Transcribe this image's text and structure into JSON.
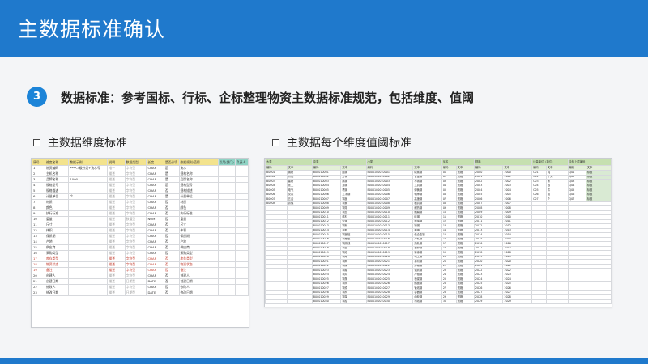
{
  "slide": {
    "title": "主数据标准确认",
    "step_number": "3",
    "headline": "数据标准：参考国标、行标、企标整理物资主数据标准规范，包括维度、值阈",
    "section_left_title": "主数据维度标准",
    "section_right_title": "主数据每个维度值阈标准"
  },
  "colors": {
    "header": "#1f79cc",
    "badge": "#1c84d8",
    "background": "#f4f5f7",
    "left_header": "#f3e38d",
    "right_header": "#c6e0b0"
  },
  "left_table": {
    "headers": [
      "序号",
      "维度名称",
      "数据示例",
      "说明",
      "数据类型",
      "长度",
      "是否必填",
      "数据规则/值阈",
      "引用(部门)",
      "负责人"
    ],
    "rows": [
      [
        "1",
        "物资编码",
        "****-3级分类+流水号",
        "唯一",
        "字符型",
        "CHAR",
        "是",
        "流水",
        "",
        ""
      ],
      [
        "2",
        "主机名称",
        "",
        "描述",
        "字符型",
        "CHAR",
        "是",
        "规格名称",
        "",
        ""
      ],
      [
        "3",
        "品牌名称",
        "1000",
        "描述",
        "字符型",
        "CHAR",
        "是",
        "品牌名称",
        "",
        ""
      ],
      [
        "4",
        "规格型号",
        "",
        "描述",
        "字符型",
        "CHAR",
        "是",
        "规格型号",
        "",
        ""
      ],
      [
        "5",
        "规格描述",
        "",
        "描述",
        "字符型",
        "CHAR",
        "否",
        "规格描述",
        "",
        ""
      ],
      [
        "6",
        "计量单位",
        "个",
        "描述",
        "字符型",
        "CHAR",
        "是",
        "计量单位",
        "",
        ""
      ],
      [
        "7",
        "材质",
        "",
        "描述",
        "字符型",
        "CHAR",
        "否",
        "材质",
        "",
        ""
      ],
      [
        "8",
        "颜色",
        "",
        "描述",
        "字符型",
        "CHAR",
        "否",
        "颜色",
        "",
        ""
      ],
      [
        "9",
        "执行标准",
        "",
        "描述",
        "字符型",
        "CHAR",
        "否",
        "执行标准",
        "",
        ""
      ],
      [
        "10",
        "重量",
        "",
        "描述",
        "数值型",
        "NUM",
        "否",
        "重量",
        "",
        ""
      ],
      [
        "11",
        "尺寸",
        "",
        "描述",
        "字符型",
        "CHAR",
        "否",
        "尺寸",
        "",
        ""
      ],
      [
        "12",
        "体积",
        "",
        "描述",
        "字符型",
        "CHAR",
        "否",
        "体积",
        "",
        ""
      ],
      [
        "13",
        "保质期",
        "",
        "描述",
        "字符型",
        "CHAR",
        "否",
        "保质期",
        "",
        ""
      ],
      [
        "14",
        "产地",
        "",
        "描述",
        "字符型",
        "CHAR",
        "否",
        "产地",
        "",
        ""
      ],
      [
        "15",
        "供应商",
        "",
        "描述",
        "字符型",
        "CHAR",
        "否",
        "供应商",
        "",
        ""
      ],
      [
        "16",
        "采购类型",
        "",
        "描述",
        "字符型",
        "CHAR",
        "否",
        "采购类型",
        "",
        ""
      ],
      [
        "17",
        "库存类型",
        "",
        "描述",
        "字符型",
        "CHAR",
        "否",
        "库存类型",
        "",
        ""
      ],
      [
        "18",
        "物资状态",
        "",
        "描述",
        "字符型",
        "CHAR",
        "否",
        "物资状态",
        "",
        ""
      ],
      [
        "19",
        "备注",
        "",
        "描述",
        "字符型",
        "CHAR",
        "否",
        "备注",
        "",
        ""
      ],
      [
        "20",
        "创建人",
        "",
        "描述",
        "字符型",
        "CHAR",
        "否",
        "创建人",
        "",
        ""
      ],
      [
        "21",
        "创建日期",
        "",
        "描述",
        "日期型",
        "DATE",
        "否",
        "创建日期",
        "",
        ""
      ],
      [
        "22",
        "修改人",
        "",
        "描述",
        "字符型",
        "CHAR",
        "否",
        "修改人",
        "",
        ""
      ],
      [
        "23",
        "修改日期",
        "",
        "描述",
        "日期型",
        "DATE",
        "否",
        "修改日期",
        "",
        ""
      ]
    ]
  },
  "right_table": {
    "group_headers": [
      "大类",
      "中类",
      "小类",
      "品名",
      "规格",
      "计量单位（单位）",
      "企标上层编码"
    ],
    "sub_headers": [
      "编码",
      "文本",
      "编码",
      "文本",
      "编码",
      "文本",
      "编码",
      "文本",
      "编码",
      "文本",
      "编码",
      "文本",
      "编码",
      "文本"
    ],
    "rows": [
      [
        "B0001",
        "钢材",
        "B00010001",
        "圆钢",
        "B000100010001",
        "碳素钢",
        "01",
        "规格",
        "2000",
        "2000",
        "C01",
        "吨",
        "Q01",
        "标准"
      ],
      [
        "B0002",
        "有色",
        "B00010002",
        "方钢",
        "B000100010002",
        "合金钢",
        "02",
        "规格",
        "2001",
        "2001",
        "C02",
        "千克",
        "Q02",
        "标准"
      ],
      [
        "B0003",
        "建材",
        "B00010003",
        "扁钢",
        "B000100010003",
        "不锈钢",
        "03",
        "规格",
        "2002",
        "2002",
        "C03",
        "米",
        "Q03",
        "标准"
      ],
      [
        "B0004",
        "化工",
        "B00010004",
        "角钢",
        "B000100010004",
        "工具钢",
        "04",
        "规格",
        "2003",
        "2003",
        "C04",
        "根",
        "Q04",
        "标准"
      ],
      [
        "B0005",
        "电气",
        "B00010005",
        "槽钢",
        "B000100010005",
        "弹簧钢",
        "05",
        "规格",
        "2004",
        "2004",
        "C05",
        "件",
        "Q05",
        "标准"
      ],
      [
        "B0006",
        "仪表",
        "B00010006",
        "工字钢",
        "B000100010006",
        "轴承钢",
        "06",
        "规格",
        "2005",
        "2005",
        "C06",
        "套",
        "Q06",
        "标准"
      ],
      [
        "B0007",
        "五金",
        "B00010007",
        "钢板",
        "B000100010007",
        "高速钢",
        "07",
        "规格",
        "2006",
        "2006",
        "C07",
        "个",
        "Q07",
        "标准"
      ],
      [
        "B0008",
        "劳保",
        "B00010008",
        "钢管",
        "B000100010008",
        "模具钢",
        "08",
        "规格",
        "2007",
        "2007",
        "",
        "",
        "",
        ""
      ],
      [
        "",
        "",
        "B00010009",
        "钢带",
        "B000100010009",
        "耐热钢",
        "09",
        "规格",
        "2008",
        "2008",
        "",
        "",
        "",
        ""
      ],
      [
        "",
        "",
        "B00010010",
        "钢丝",
        "B000100010010",
        "耐磨钢",
        "10",
        "规格",
        "2009",
        "2009",
        "",
        "",
        "",
        ""
      ],
      [
        "",
        "",
        "B00010011",
        "线材",
        "B000100010011",
        "硅钢",
        "11",
        "规格",
        "2010",
        "2010",
        "",
        "",
        "",
        ""
      ],
      [
        "",
        "",
        "B00010012",
        "型钢",
        "B000100010012",
        "焊接钢",
        "12",
        "规格",
        "2011",
        "2011",
        "",
        "",
        "",
        ""
      ],
      [
        "",
        "",
        "B00010013",
        "钢轨",
        "B000100010013",
        "铸钢",
        "13",
        "规格",
        "2012",
        "2012",
        "",
        "",
        "",
        ""
      ],
      [
        "",
        "",
        "B00010014",
        "钢筋",
        "B000100010014",
        "锻钢",
        "14",
        "规格",
        "2013",
        "2013",
        "",
        "",
        "",
        ""
      ],
      [
        "",
        "",
        "B00010015",
        "钢板桩",
        "B000100010015",
        "低合金钢",
        "15",
        "规格",
        "2014",
        "2014",
        "",
        "",
        "",
        ""
      ],
      [
        "",
        "",
        "B00010016",
        "钢格板",
        "B000100010016",
        "冷轧钢",
        "16",
        "规格",
        "2015",
        "2015",
        "",
        "",
        "",
        ""
      ],
      [
        "",
        "",
        "B00010017",
        "钢绞线",
        "B000100010017",
        "热轧钢",
        "17",
        "规格",
        "2016",
        "2016",
        "",
        "",
        "",
        ""
      ],
      [
        "",
        "",
        "B00010018",
        "钢锭",
        "B000100010018",
        "镀锌钢",
        "18",
        "规格",
        "2017",
        "2017",
        "",
        "",
        "",
        ""
      ],
      [
        "",
        "",
        "B00010019",
        "钢坯",
        "B000100010019",
        "彩涂钢",
        "19",
        "规格",
        "2018",
        "2018",
        "",
        "",
        "",
        ""
      ],
      [
        "",
        "",
        "B00010020",
        "钢球",
        "B000100010020",
        "电工钢",
        "20",
        "规格",
        "2019",
        "2019",
        "",
        "",
        "",
        ""
      ],
      [
        "",
        "",
        "B00010021",
        "钢网",
        "B000100010021",
        "易切钢",
        "21",
        "规格",
        "2020",
        "2020",
        "",
        "",
        "",
        ""
      ],
      [
        "",
        "",
        "B00010022",
        "钢棒",
        "B000100010022",
        "渗碳钢",
        "22",
        "规格",
        "2021",
        "2021",
        "",
        "",
        "",
        ""
      ],
      [
        "",
        "",
        "B00010023",
        "钢卷",
        "B000100010023",
        "调质钢",
        "23",
        "规格",
        "2022",
        "2022",
        "",
        "",
        "",
        ""
      ],
      [
        "",
        "",
        "B00010024",
        "钢片",
        "B000100010024",
        "冷镦钢",
        "24",
        "规格",
        "2023",
        "2023",
        "",
        "",
        "",
        ""
      ],
      [
        "",
        "",
        "B00010025",
        "钢条",
        "B000100010025",
        "桥梁钢",
        "25",
        "规格",
        "2024",
        "2024",
        "",
        "",
        "",
        ""
      ],
      [
        "",
        "",
        "B00010026",
        "钢块",
        "B000100010026",
        "船板钢",
        "26",
        "规格",
        "2025",
        "2025",
        "",
        "",
        "",
        ""
      ],
      [
        "",
        "",
        "B00010027",
        "钢件",
        "B000100010027",
        "管线钢",
        "27",
        "规格",
        "2026",
        "2026",
        "",
        "",
        "",
        ""
      ],
      [
        "",
        "",
        "B00010028",
        "钢构",
        "B000100010028",
        "容器钢",
        "28",
        "规格",
        "2027",
        "2027",
        "",
        "",
        "",
        ""
      ],
      [
        "",
        "",
        "B00010029",
        "钢架",
        "B000100010029",
        "齿轮钢",
        "29",
        "规格",
        "2028",
        "2028",
        "",
        "",
        "",
        ""
      ],
      [
        "",
        "",
        "B00010030",
        "钢柱",
        "B000100010030",
        "帘线钢",
        "30",
        "规格",
        "2029",
        "2029",
        "",
        "",
        "",
        ""
      ]
    ]
  }
}
